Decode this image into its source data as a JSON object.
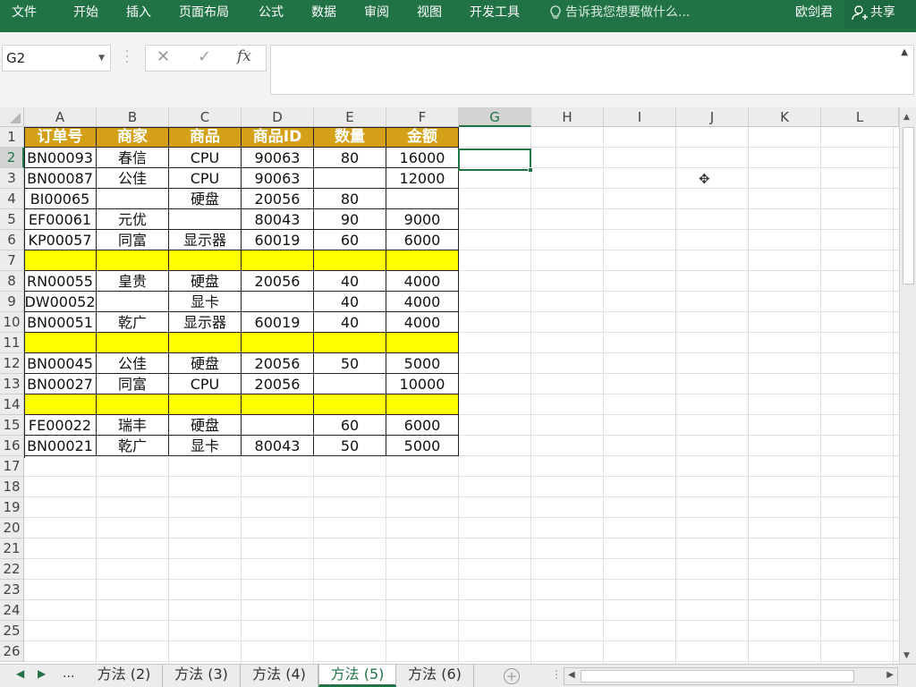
{
  "ribbon": {
    "tabs": [
      "文件",
      "开始",
      "插入",
      "页面布局",
      "公式",
      "数据",
      "审阅",
      "视图",
      "开发工具"
    ],
    "tell_me": "告诉我您想要做什么...",
    "user": "欧剑君",
    "share": "共享"
  },
  "formula_bar": {
    "name_box": "G2",
    "cancel": "✕",
    "enter": "✓",
    "fx": "fx",
    "content": ""
  },
  "columns": [
    "A",
    "B",
    "C",
    "D",
    "E",
    "F",
    "G",
    "H",
    "I",
    "J",
    "K",
    "L"
  ],
  "selected_column": "G",
  "rows": [
    "1",
    "2",
    "3",
    "4",
    "5",
    "6",
    "7",
    "8",
    "9",
    "10",
    "11",
    "12",
    "13",
    "14",
    "15",
    "16",
    "17",
    "18",
    "19",
    "20",
    "21",
    "22",
    "23",
    "24",
    "25",
    "26"
  ],
  "selected_row": "2",
  "table": {
    "headers": [
      "订单号",
      "商家",
      "商品",
      "商品ID",
      "数量",
      "金额"
    ],
    "rows": [
      [
        "BN00093",
        "春信",
        "CPU",
        "90063",
        "80",
        "16000"
      ],
      [
        "BN00087",
        "公佳",
        "CPU",
        "90063",
        "",
        "12000"
      ],
      [
        "BI00065",
        "",
        "硬盘",
        "20056",
        "80",
        ""
      ],
      [
        "EF00061",
        "元优",
        "",
        "80043",
        "90",
        "9000"
      ],
      [
        "KP00057",
        "同富",
        "显示器",
        "60019",
        "60",
        "6000"
      ],
      [
        "",
        "",
        "",
        "",
        "",
        ""
      ],
      [
        "RN00055",
        "皇贵",
        "硬盘",
        "20056",
        "40",
        "4000"
      ],
      [
        "DW00052",
        "",
        "显卡",
        "",
        "40",
        "4000"
      ],
      [
        "BN00051",
        "乾广",
        "显示器",
        "60019",
        "40",
        "4000"
      ],
      [
        "",
        "",
        "",
        "",
        "",
        ""
      ],
      [
        "BN00045",
        "公佳",
        "硬盘",
        "20056",
        "50",
        "5000"
      ],
      [
        "BN00027",
        "同富",
        "CPU",
        "20056",
        "",
        "10000"
      ],
      [
        "",
        "",
        "",
        "",
        "",
        ""
      ],
      [
        "FE00022",
        "瑞丰",
        "硬盘",
        "",
        "60",
        "6000"
      ],
      [
        "BN00021",
        "乾广",
        "显卡",
        "80043",
        "50",
        "5000"
      ]
    ],
    "highlight_rows": [
      5,
      9,
      12
    ],
    "header_color": "#d4a017",
    "highlight_color": "#ffff00"
  },
  "sheet_tabs": {
    "more": "...",
    "tabs": [
      "方法 (2)",
      "方法 (3)",
      "方法 (4)",
      "方法 (5)",
      "方法 (6)"
    ],
    "active": "方法 (5)",
    "add": "+"
  },
  "colors": {
    "accent": "#217346"
  }
}
